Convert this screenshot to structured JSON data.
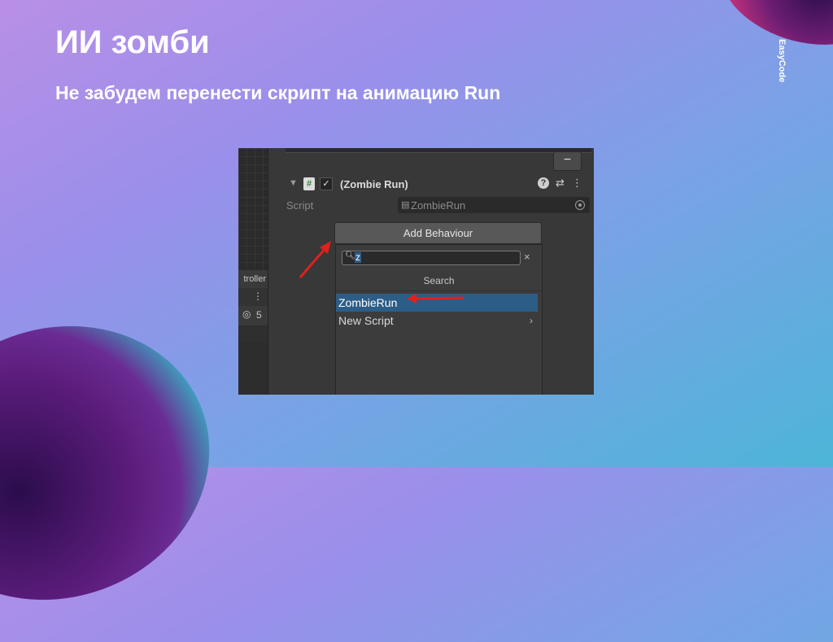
{
  "slide": {
    "title": "ИИ зомби",
    "subtitle": "Не забудем перенести скрипт на анимацию Run",
    "brand": "EasyCode"
  },
  "unity": {
    "left_panel": {
      "tab_label": "troller",
      "layer_count": "5"
    },
    "remove_button": "−",
    "component": {
      "title": "(Zombie Run)",
      "enabled": true
    },
    "script_field": {
      "label": "Script",
      "value": "ZombieRun"
    },
    "add_behaviour_button": "Add Behaviour",
    "popup": {
      "search_query": "z",
      "clear": "×",
      "section_title": "Search",
      "items": [
        {
          "label": "ZombieRun",
          "selected": true
        },
        {
          "label": "New Script",
          "selected": false,
          "submenu": true
        }
      ]
    }
  },
  "colors": {
    "annotation_arrow": "#e0201c",
    "selection": "#2c5d87"
  }
}
